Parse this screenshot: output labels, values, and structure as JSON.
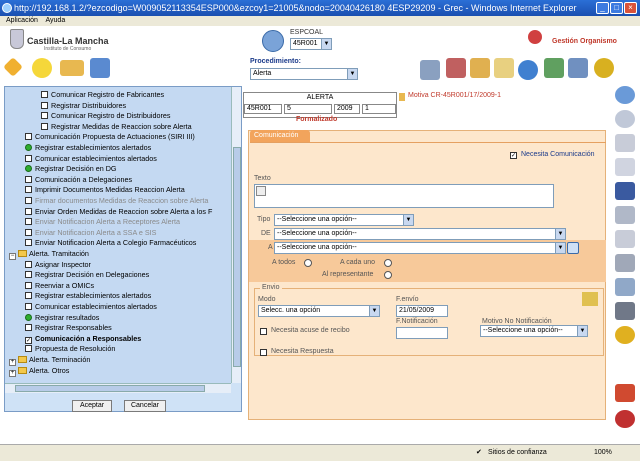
{
  "window": {
    "title": "http://192.168.1.2/?ezcodigo=W009052113354ESP000&ezcoy1=21005&nodo=20040426180 4ESP29209 - Grec - Windows Internet Explorer"
  },
  "menu": {
    "items": [
      "Aplicación",
      "Ayuda"
    ]
  },
  "brand": {
    "name": "Castilla-La Mancha",
    "subtitle": "Instituto de Consumo"
  },
  "user": {
    "label": "ESPCOAL",
    "selected": "45R001"
  },
  "gestion": "Gestión Organismo",
  "procedimiento": {
    "label": "Procedimiento:",
    "selected": "Alerta"
  },
  "alert": {
    "header": "ALERTA",
    "cells": [
      "45R001",
      "5",
      "2009",
      "1"
    ],
    "status": "Formalizado",
    "motiva": "Motiva CR-45R001/17/2009-1"
  },
  "tree": {
    "items": [
      {
        "label": "Comunicar Registro de Fabricantes",
        "indent": 3,
        "kind": "cb",
        "grey": false
      },
      {
        "label": "Registrar Distribuidores",
        "indent": 3,
        "kind": "cb",
        "grey": false
      },
      {
        "label": "Comunicar Registro de Distribuidores",
        "indent": 3,
        "kind": "cb",
        "grey": false
      },
      {
        "label": "Registrar Medidas de Reaccion sobre Alerta",
        "indent": 3,
        "kind": "cb",
        "grey": false
      },
      {
        "label": "Comunicación Propuesta de Actuaciones (SIRI III)",
        "indent": 2,
        "kind": "cb",
        "grey": false
      },
      {
        "label": "Registrar establecimientos alertados",
        "indent": 2,
        "kind": "green",
        "grey": false
      },
      {
        "label": "Comunicar establecimientos alertados",
        "indent": 2,
        "kind": "cb",
        "grey": false
      },
      {
        "label": "Registrar Decisión en DG",
        "indent": 2,
        "kind": "green",
        "grey": false
      },
      {
        "label": "Comunicación a Delegaciones",
        "indent": 2,
        "kind": "cb",
        "grey": false
      },
      {
        "label": "Imprimir Documentos Medidas Reaccion Alerta",
        "indent": 2,
        "kind": "cb",
        "grey": false
      },
      {
        "label": "Firmar documentos Medidas de Reaccion sobre Alerta",
        "indent": 2,
        "kind": "cb",
        "grey": true
      },
      {
        "label": "Enviar Orden Medidas de Reaccion sobre Alerta a los F",
        "indent": 2,
        "kind": "cb",
        "grey": false
      },
      {
        "label": "Enviar Notificacion Alerta a Receptores Alerta",
        "indent": 2,
        "kind": "cb",
        "grey": true
      },
      {
        "label": "Enviar Notificacion Alerta a SSA e SIS",
        "indent": 2,
        "kind": "cb",
        "grey": true
      },
      {
        "label": "Enviar Notificacion Alerta a Colegio Farmacéuticos",
        "indent": 2,
        "kind": "cb",
        "grey": false
      },
      {
        "label": "Alerta. Tramitación",
        "indent": 0,
        "kind": "folder-open",
        "grey": false
      },
      {
        "label": "Asignar Inspector",
        "indent": 2,
        "kind": "cb",
        "grey": false
      },
      {
        "label": "Registrar Decisión en Delegaciones",
        "indent": 2,
        "kind": "cb",
        "grey": false
      },
      {
        "label": "Reenviar a OMICs",
        "indent": 2,
        "kind": "cb",
        "grey": false
      },
      {
        "label": "Registrar establecimientos alertados",
        "indent": 2,
        "kind": "cb",
        "grey": false
      },
      {
        "label": "Comunicar establecimientos alertados",
        "indent": 2,
        "kind": "cb",
        "grey": false
      },
      {
        "label": "Registrar resultados",
        "indent": 2,
        "kind": "green",
        "grey": false
      },
      {
        "label": "Registrar Responsables",
        "indent": 2,
        "kind": "cb",
        "grey": false
      },
      {
        "label": "Comunicación a Responsables",
        "indent": 2,
        "kind": "checked",
        "grey": false
      },
      {
        "label": "Propuesta de Resolución",
        "indent": 2,
        "kind": "cb",
        "grey": false
      },
      {
        "label": "Alerta. Terminación",
        "indent": 0,
        "kind": "folder-closed",
        "grey": false
      },
      {
        "label": "Alerta. Otros",
        "indent": 0,
        "kind": "folder-closed",
        "grey": false
      }
    ]
  },
  "buttons": {
    "accept": "Aceptar",
    "cancel": "Cancelar"
  },
  "comm": {
    "tab": "Comunicación",
    "necesita": "Necesita Comunicación",
    "texto": "Texto",
    "tipo_label": "Tipo",
    "tipo_value": "--Seleccione una opción--",
    "de_label": "DE",
    "de_value": "--Seleccione una opción--",
    "a_label": "A",
    "a_value": "--Seleccione una opción--",
    "a_todos": "A todos",
    "a_cada_uno": "A cada uno",
    "al_representante": "Al representante",
    "envio": "Envio",
    "modo_label": "Modo",
    "modo_value": "Selecc. una opción",
    "fenvio_label": "F.envío",
    "fenvio_value": "21/05/2009",
    "acuse": "Necesita acuse de recibo",
    "fnotif_label": "F.Notificación",
    "motivo_label": "Motivo No Notificación",
    "motivo_value": "--Seleccione una opción--",
    "respuesta": "Necesita Respuesta"
  },
  "status": {
    "zone": "Sitios de confianza",
    "zoom": "100%"
  }
}
